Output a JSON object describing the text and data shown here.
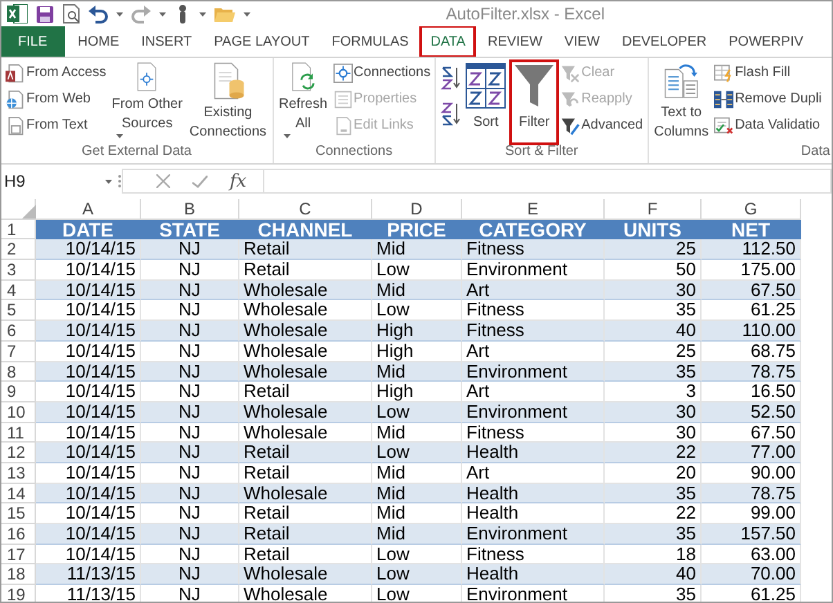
{
  "window": {
    "title": "AutoFilter.xlsx - Excel"
  },
  "tabs": [
    {
      "label": "FILE",
      "kind": "file",
      "selected": false,
      "highlighted": false
    },
    {
      "label": "HOME",
      "kind": "tab",
      "selected": false,
      "highlighted": false
    },
    {
      "label": "INSERT",
      "kind": "tab",
      "selected": false,
      "highlighted": false
    },
    {
      "label": "PAGE LAYOUT",
      "kind": "tab",
      "selected": false,
      "highlighted": false
    },
    {
      "label": "FORMULAS",
      "kind": "tab",
      "selected": false,
      "highlighted": false
    },
    {
      "label": "DATA",
      "kind": "tab",
      "selected": true,
      "highlighted": true
    },
    {
      "label": "REVIEW",
      "kind": "tab",
      "selected": false,
      "highlighted": false
    },
    {
      "label": "VIEW",
      "kind": "tab",
      "selected": false,
      "highlighted": false
    },
    {
      "label": "DEVELOPER",
      "kind": "tab",
      "selected": false,
      "highlighted": false
    },
    {
      "label": "POWERPIV",
      "kind": "tab",
      "selected": false,
      "highlighted": false
    }
  ],
  "ribbon": {
    "groups": [
      {
        "label": "Get External Data",
        "items": [
          {
            "kind": "stack",
            "items": [
              {
                "label": "From Access",
                "disabled": false
              },
              {
                "label": "From Web",
                "disabled": false
              },
              {
                "label": "From Text",
                "disabled": false
              }
            ]
          },
          {
            "kind": "large",
            "lines": [
              "From Other",
              "Sources"
            ],
            "dropdown": true,
            "disabled": false,
            "highlighted": false
          },
          {
            "kind": "large",
            "lines": [
              "Existing",
              "Connections"
            ],
            "dropdown": false,
            "disabled": false,
            "highlighted": false
          }
        ]
      },
      {
        "label": "Connections",
        "items": [
          {
            "kind": "large",
            "lines": [
              "Refresh",
              "All"
            ],
            "dropdown": true,
            "disabled": false,
            "highlighted": false
          },
          {
            "kind": "stack",
            "items": [
              {
                "label": "Connections",
                "disabled": false
              },
              {
                "label": "Properties",
                "disabled": true
              },
              {
                "label": "Edit Links",
                "disabled": true
              }
            ]
          }
        ]
      },
      {
        "label": "Sort & Filter",
        "items": [
          {
            "kind": "sort_pair"
          },
          {
            "kind": "large",
            "lines": [
              "Sort"
            ],
            "dropdown": false,
            "disabled": false,
            "highlighted": false
          },
          {
            "kind": "large",
            "lines": [
              "Filter"
            ],
            "dropdown": false,
            "disabled": false,
            "highlighted": true
          },
          {
            "kind": "stack",
            "items": [
              {
                "label": "Clear",
                "disabled": true
              },
              {
                "label": "Reapply",
                "disabled": true
              },
              {
                "label": "Advanced",
                "disabled": false
              }
            ]
          }
        ]
      },
      {
        "label": "Data",
        "items": [
          {
            "kind": "large",
            "lines": [
              "Text to",
              "Columns"
            ],
            "dropdown": false,
            "disabled": false,
            "highlighted": false
          },
          {
            "kind": "stack",
            "items": [
              {
                "label": "Flash Fill",
                "disabled": false
              },
              {
                "label": "Remove Dupli",
                "disabled": false
              },
              {
                "label": "Data Validatio",
                "disabled": false
              }
            ]
          }
        ]
      }
    ]
  },
  "formula_bar": {
    "name_box": "H9",
    "fx": "fx"
  },
  "sheet": {
    "columns": [
      "A",
      "B",
      "C",
      "D",
      "E",
      "F",
      "G"
    ],
    "row_numbers": [
      "1",
      "2",
      "3",
      "4",
      "5",
      "6",
      "7",
      "8",
      "9",
      "10",
      "11",
      "12",
      "13",
      "14",
      "15",
      "16",
      "17",
      "18",
      "19"
    ],
    "header": [
      "DATE",
      "STATE",
      "CHANNEL",
      "PRICE",
      "CATEGORY",
      "UNITS",
      "NET"
    ],
    "rows": [
      [
        "10/14/15",
        "NJ",
        "Retail",
        "Mid",
        "Fitness",
        "25",
        "112.50"
      ],
      [
        "10/14/15",
        "NJ",
        "Retail",
        "Low",
        "Environment",
        "50",
        "175.00"
      ],
      [
        "10/14/15",
        "NJ",
        "Wholesale",
        "Mid",
        "Art",
        "30",
        "67.50"
      ],
      [
        "10/14/15",
        "NJ",
        "Wholesale",
        "Low",
        "Fitness",
        "35",
        "61.25"
      ],
      [
        "10/14/15",
        "NJ",
        "Wholesale",
        "High",
        "Fitness",
        "40",
        "110.00"
      ],
      [
        "10/14/15",
        "NJ",
        "Wholesale",
        "High",
        "Art",
        "25",
        "68.75"
      ],
      [
        "10/14/15",
        "NJ",
        "Wholesale",
        "Mid",
        "Environment",
        "35",
        "78.75"
      ],
      [
        "10/14/15",
        "NJ",
        "Retail",
        "High",
        "Art",
        "3",
        "16.50"
      ],
      [
        "10/14/15",
        "NJ",
        "Wholesale",
        "Low",
        "Environment",
        "30",
        "52.50"
      ],
      [
        "10/14/15",
        "NJ",
        "Wholesale",
        "Mid",
        "Fitness",
        "30",
        "67.50"
      ],
      [
        "10/14/15",
        "NJ",
        "Retail",
        "Low",
        "Health",
        "22",
        "77.00"
      ],
      [
        "10/14/15",
        "NJ",
        "Retail",
        "Mid",
        "Art",
        "20",
        "90.00"
      ],
      [
        "10/14/15",
        "NJ",
        "Wholesale",
        "Mid",
        "Health",
        "35",
        "78.75"
      ],
      [
        "10/14/15",
        "NJ",
        "Retail",
        "Mid",
        "Health",
        "22",
        "99.00"
      ],
      [
        "10/14/15",
        "NJ",
        "Retail",
        "Mid",
        "Environment",
        "35",
        "157.50"
      ],
      [
        "10/14/15",
        "NJ",
        "Retail",
        "Low",
        "Fitness",
        "18",
        "63.00"
      ],
      [
        "11/13/15",
        "NJ",
        "Wholesale",
        "Low",
        "Health",
        "40",
        "70.00"
      ],
      [
        "11/13/15",
        "NJ",
        "Wholesale",
        "Low",
        "Environment",
        "35",
        "61.25"
      ]
    ]
  }
}
